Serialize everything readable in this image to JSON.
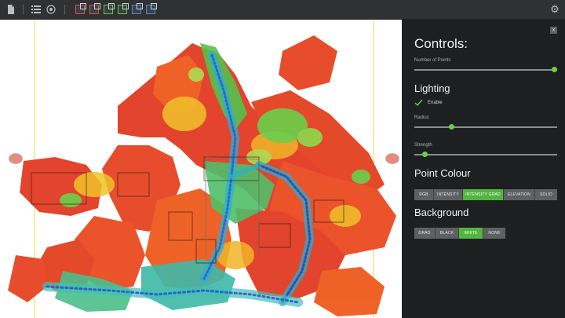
{
  "toolbar": {
    "icons": [
      "document-icon",
      "list-icon",
      "layers-icon"
    ],
    "view_cubes": [
      "view-cube-icon",
      "view-cube-icon",
      "view-cube-icon",
      "view-cube-icon",
      "view-cube-icon",
      "view-cube-icon"
    ]
  },
  "controls": {
    "title": "Controls:",
    "close_label": "x",
    "number_of_points": {
      "label": "Number of Points",
      "value_fraction": 0.98
    },
    "lighting": {
      "heading": "Lighting",
      "enable_label": "Enable",
      "enabled": true,
      "radius": {
        "label": "Radius",
        "value_fraction": 0.26
      },
      "strength": {
        "label": "Strength",
        "value_fraction": 0.07
      }
    },
    "point_colour": {
      "heading": "Point Colour",
      "options": [
        "RGB",
        "INTENSITY",
        "INTENSITY GRAD",
        "ELEVATION",
        "SOLID"
      ],
      "selected": "INTENSITY GRAD"
    },
    "background": {
      "heading": "Background",
      "options": [
        "GRAD",
        "BLACK",
        "WHITE",
        "NONE"
      ],
      "selected": "WHITE"
    }
  },
  "colors": {
    "accent": "#52b540",
    "panel_bg": "#1d1f20",
    "toolbar_bg": "#2f3133"
  }
}
